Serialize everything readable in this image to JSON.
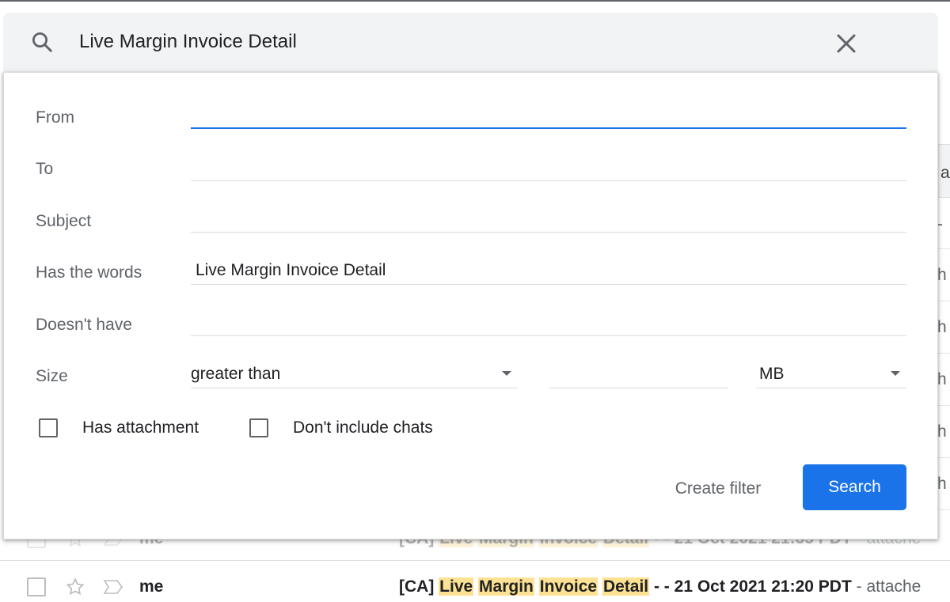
{
  "search": {
    "query": "Live Margin Invoice Detail"
  },
  "advanced": {
    "fields": [
      {
        "label": "From",
        "value": ""
      },
      {
        "label": "To",
        "value": ""
      },
      {
        "label": "Subject",
        "value": ""
      },
      {
        "label": "Has the words",
        "value": "Live Margin Invoice Detail"
      },
      {
        "label": "Doesn't have",
        "value": ""
      }
    ],
    "size": {
      "label": "Size",
      "comparator": "greater than",
      "number": "",
      "unit": "MB"
    },
    "has_attachment_label": "Has attachment",
    "dont_include_chats_label": "Don't include chats",
    "create_filter_label": "Create filter",
    "search_label": "Search"
  },
  "background": {
    "right_tab_text": "a",
    "right_fragments": [
      "-",
      "h",
      "h",
      "h",
      "h",
      "h",
      "h"
    ],
    "ghost_row": {
      "sender": "me",
      "prefix": "[CA]",
      "words": [
        "Live",
        "Margin",
        "Invoice",
        "Detail"
      ],
      "suffix": "- - 21 Oct 2021 21:35 PDT",
      "snippet": " - attache"
    },
    "row": {
      "sender": "me",
      "prefix": "[CA]",
      "words": [
        "Live",
        "Margin",
        "Invoice",
        "Detail"
      ],
      "suffix": "- - 21 Oct 2021 21:20 PDT",
      "snippet": " - attache"
    }
  },
  "colors": {
    "accent": "#1a73e8",
    "highlight": "#fde293",
    "search_bar_bg": "#f1f3f4"
  }
}
